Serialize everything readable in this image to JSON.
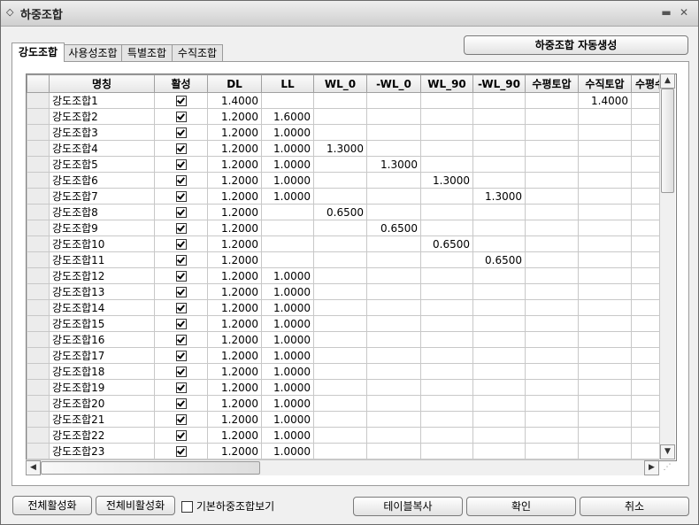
{
  "window": {
    "title": "하중조합",
    "title_icon": "◇"
  },
  "tabs": [
    {
      "label": "강도조합",
      "active": true
    },
    {
      "label": "사용성조합",
      "active": false
    },
    {
      "label": "특별조합",
      "active": false
    },
    {
      "label": "수직조합",
      "active": false
    }
  ],
  "actions": {
    "auto_generate": "하중조합 자동생성",
    "activate_all": "전체활성화",
    "deactivate_all": "전체비활성화",
    "show_default": "기본하중조합보기",
    "copy_table": "테이블복사",
    "ok": "확인",
    "cancel": "취소"
  },
  "grid": {
    "columns": [
      "명칭",
      "활성",
      "DL",
      "LL",
      "WL_0",
      "-WL_0",
      "WL_90",
      "-WL_90",
      "수평토압",
      "수직토압",
      "수평수"
    ],
    "rows": [
      {
        "name": "강도조합1",
        "active": true,
        "DL": "1.4000",
        "LL": "",
        "WL_0": "",
        "-WL_0": "",
        "WL_90": "",
        "-WL_90": "",
        "수평토압": "",
        "수직토압": "1.4000",
        "수평수": ""
      },
      {
        "name": "강도조합2",
        "active": true,
        "DL": "1.2000",
        "LL": "1.6000",
        "WL_0": "",
        "-WL_0": "",
        "WL_90": "",
        "-WL_90": "",
        "수평토압": "",
        "수직토압": "",
        "수평수": ""
      },
      {
        "name": "강도조합3",
        "active": true,
        "DL": "1.2000",
        "LL": "1.0000",
        "WL_0": "",
        "-WL_0": "",
        "WL_90": "",
        "-WL_90": "",
        "수평토압": "",
        "수직토압": "",
        "수평수": ""
      },
      {
        "name": "강도조합4",
        "active": true,
        "DL": "1.2000",
        "LL": "1.0000",
        "WL_0": "1.3000",
        "-WL_0": "",
        "WL_90": "",
        "-WL_90": "",
        "수평토압": "",
        "수직토압": "",
        "수평수": ""
      },
      {
        "name": "강도조합5",
        "active": true,
        "DL": "1.2000",
        "LL": "1.0000",
        "WL_0": "",
        "-WL_0": "1.3000",
        "WL_90": "",
        "-WL_90": "",
        "수평토압": "",
        "수직토압": "",
        "수평수": ""
      },
      {
        "name": "강도조합6",
        "active": true,
        "DL": "1.2000",
        "LL": "1.0000",
        "WL_0": "",
        "-WL_0": "",
        "WL_90": "1.3000",
        "-WL_90": "",
        "수평토압": "",
        "수직토압": "",
        "수평수": ""
      },
      {
        "name": "강도조합7",
        "active": true,
        "DL": "1.2000",
        "LL": "1.0000",
        "WL_0": "",
        "-WL_0": "",
        "WL_90": "",
        "-WL_90": "1.3000",
        "수평토압": "",
        "수직토압": "",
        "수평수": ""
      },
      {
        "name": "강도조합8",
        "active": true,
        "DL": "1.2000",
        "LL": "",
        "WL_0": "0.6500",
        "-WL_0": "",
        "WL_90": "",
        "-WL_90": "",
        "수평토압": "",
        "수직토압": "",
        "수평수": ""
      },
      {
        "name": "강도조합9",
        "active": true,
        "DL": "1.2000",
        "LL": "",
        "WL_0": "",
        "-WL_0": "0.6500",
        "WL_90": "",
        "-WL_90": "",
        "수평토압": "",
        "수직토압": "",
        "수평수": ""
      },
      {
        "name": "강도조합10",
        "active": true,
        "DL": "1.2000",
        "LL": "",
        "WL_0": "",
        "-WL_0": "",
        "WL_90": "0.6500",
        "-WL_90": "",
        "수평토압": "",
        "수직토압": "",
        "수평수": ""
      },
      {
        "name": "강도조합11",
        "active": true,
        "DL": "1.2000",
        "LL": "",
        "WL_0": "",
        "-WL_0": "",
        "WL_90": "",
        "-WL_90": "0.6500",
        "수평토압": "",
        "수직토압": "",
        "수평수": ""
      },
      {
        "name": "강도조합12",
        "active": true,
        "DL": "1.2000",
        "LL": "1.0000",
        "WL_0": "",
        "-WL_0": "",
        "WL_90": "",
        "-WL_90": "",
        "수평토압": "",
        "수직토압": "",
        "수평수": ""
      },
      {
        "name": "강도조합13",
        "active": true,
        "DL": "1.2000",
        "LL": "1.0000",
        "WL_0": "",
        "-WL_0": "",
        "WL_90": "",
        "-WL_90": "",
        "수평토압": "",
        "수직토압": "",
        "수평수": ""
      },
      {
        "name": "강도조합14",
        "active": true,
        "DL": "1.2000",
        "LL": "1.0000",
        "WL_0": "",
        "-WL_0": "",
        "WL_90": "",
        "-WL_90": "",
        "수평토압": "",
        "수직토압": "",
        "수평수": ""
      },
      {
        "name": "강도조합15",
        "active": true,
        "DL": "1.2000",
        "LL": "1.0000",
        "WL_0": "",
        "-WL_0": "",
        "WL_90": "",
        "-WL_90": "",
        "수평토압": "",
        "수직토압": "",
        "수평수": ""
      },
      {
        "name": "강도조합16",
        "active": true,
        "DL": "1.2000",
        "LL": "1.0000",
        "WL_0": "",
        "-WL_0": "",
        "WL_90": "",
        "-WL_90": "",
        "수평토압": "",
        "수직토압": "",
        "수평수": ""
      },
      {
        "name": "강도조합17",
        "active": true,
        "DL": "1.2000",
        "LL": "1.0000",
        "WL_0": "",
        "-WL_0": "",
        "WL_90": "",
        "-WL_90": "",
        "수평토압": "",
        "수직토압": "",
        "수평수": ""
      },
      {
        "name": "강도조합18",
        "active": true,
        "DL": "1.2000",
        "LL": "1.0000",
        "WL_0": "",
        "-WL_0": "",
        "WL_90": "",
        "-WL_90": "",
        "수평토압": "",
        "수직토압": "",
        "수평수": ""
      },
      {
        "name": "강도조합19",
        "active": true,
        "DL": "1.2000",
        "LL": "1.0000",
        "WL_0": "",
        "-WL_0": "",
        "WL_90": "",
        "-WL_90": "",
        "수평토압": "",
        "수직토압": "",
        "수평수": ""
      },
      {
        "name": "강도조합20",
        "active": true,
        "DL": "1.2000",
        "LL": "1.0000",
        "WL_0": "",
        "-WL_0": "",
        "WL_90": "",
        "-WL_90": "",
        "수평토압": "",
        "수직토압": "",
        "수평수": ""
      },
      {
        "name": "강도조합21",
        "active": true,
        "DL": "1.2000",
        "LL": "1.0000",
        "WL_0": "",
        "-WL_0": "",
        "WL_90": "",
        "-WL_90": "",
        "수평토압": "",
        "수직토압": "",
        "수평수": ""
      },
      {
        "name": "강도조합22",
        "active": true,
        "DL": "1.2000",
        "LL": "1.0000",
        "WL_0": "",
        "-WL_0": "",
        "WL_90": "",
        "-WL_90": "",
        "수평토압": "",
        "수직토압": "",
        "수평수": ""
      },
      {
        "name": "강도조합23",
        "active": true,
        "DL": "1.2000",
        "LL": "1.0000",
        "WL_0": "",
        "-WL_0": "",
        "WL_90": "",
        "-WL_90": "",
        "수평토압": "",
        "수직토압": "",
        "수평수": ""
      }
    ]
  },
  "icons": {
    "title": "diamond-icon",
    "minimize": "minimize-icon",
    "close": "close-icon",
    "scroll_up": "arrow-up-icon",
    "scroll_down": "arrow-down-icon",
    "scroll_left": "arrow-left-icon",
    "scroll_right": "arrow-right-icon",
    "grip": "resize-grip-icon"
  }
}
